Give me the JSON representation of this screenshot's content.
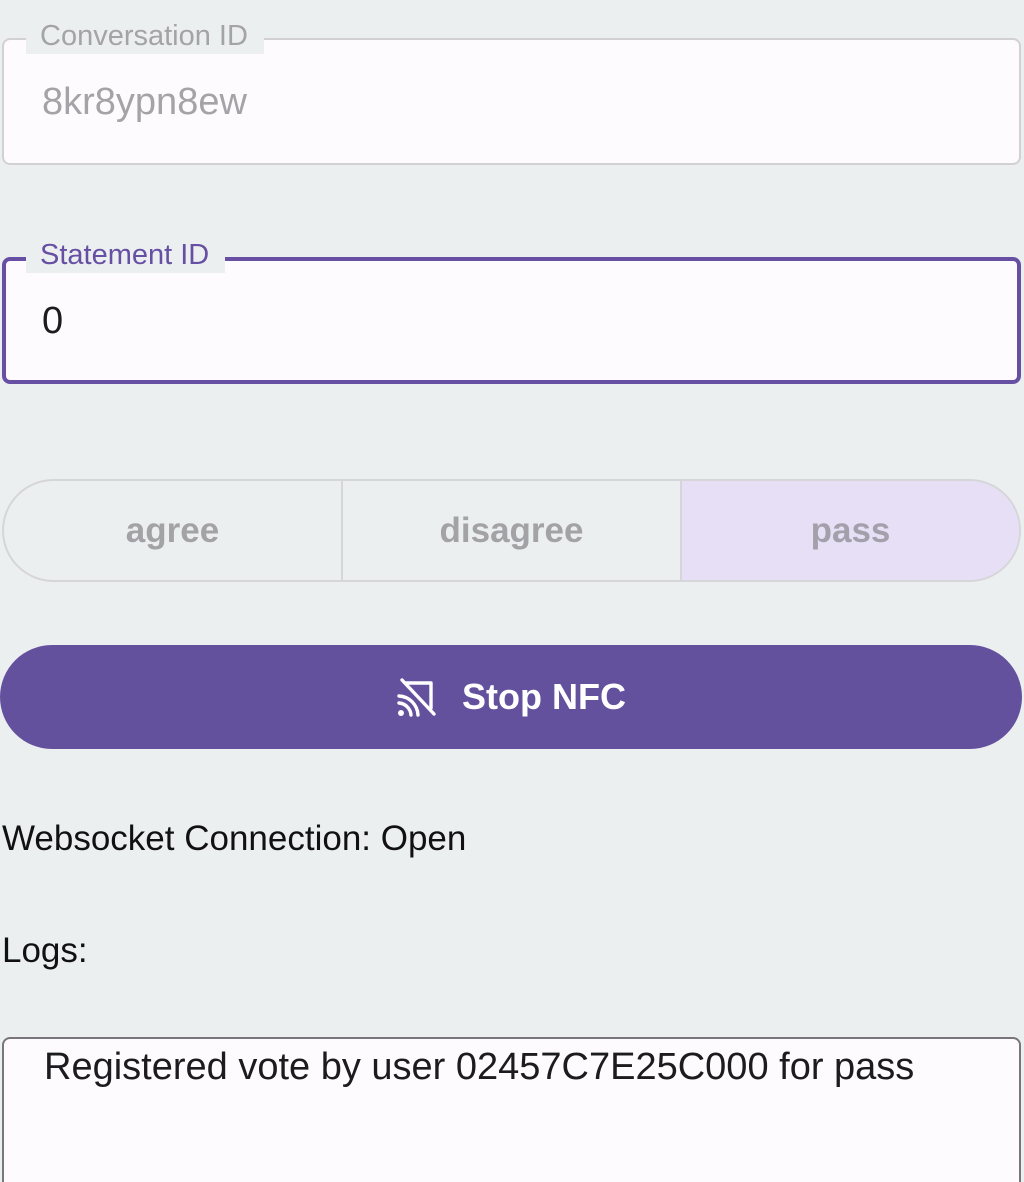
{
  "conversation": {
    "label": "Conversation ID",
    "value": "8kr8ypn8ew"
  },
  "statement": {
    "label": "Statement ID",
    "value": "0"
  },
  "vote_options": {
    "agree": "agree",
    "disagree": "disagree",
    "pass": "pass",
    "selected": "pass"
  },
  "nfc_button": {
    "label": "Stop NFC",
    "icon": "nfc-off-icon"
  },
  "status": {
    "websocket": "Websocket Connection: Open"
  },
  "logs": {
    "label": "Logs:",
    "text": "Registered vote by user 02457C7E25C000 for pass"
  },
  "colors": {
    "primary": "#64519e",
    "focused_outline": "#6750a4",
    "selected_segment": "#e6dff5",
    "background": "#eceff0"
  }
}
